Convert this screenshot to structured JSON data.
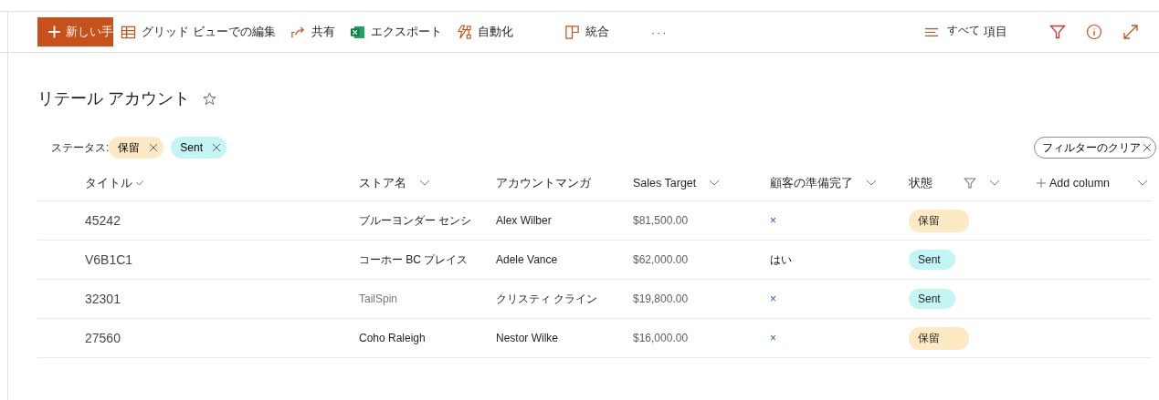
{
  "toolbar": {
    "new_button": "新しい手",
    "commands": [
      {
        "kind": "grid",
        "label": "グリッド ビューでの編集"
      },
      {
        "kind": "share",
        "label": "共有"
      },
      {
        "kind": "excel",
        "label": "エクスポート"
      },
      {
        "kind": "automate",
        "label": "自動化"
      },
      {
        "kind": "integrate",
        "label": "統合"
      },
      {
        "kind": "more",
        "label": "···"
      }
    ],
    "view": {
      "small": "すべて",
      "label": "項目"
    }
  },
  "list_title": "リテール アカウント",
  "filters": {
    "label": "ステータス:",
    "chips": [
      {
        "label": "保留",
        "color": "#fdeac4"
      },
      {
        "label": "Sent",
        "color": "#c4f5f5"
      }
    ],
    "clear": "フィルターのクリア"
  },
  "table": {
    "columns": [
      {
        "label": "タイトル",
        "kind": "sort"
      },
      {
        "label": "ストア名",
        "kind": "menu"
      },
      {
        "label": "アカウントマンガ",
        "kind": "plain"
      },
      {
        "label": "Sales Target",
        "kind": "menu"
      },
      {
        "label": "顧客の準備完了",
        "kind": "menu"
      },
      {
        "label": "状態",
        "kind": "filtered"
      },
      {
        "label": "Add column",
        "kind": "add"
      }
    ],
    "rows": [
      {
        "title": "45242",
        "store": "ブルーヨンダー センシ",
        "store_muted": false,
        "manager": "Alex Wilber",
        "sales": "$81,500.00",
        "ready": {
          "text": "×",
          "kind": "mark"
        },
        "status": {
          "label": "保留",
          "color": "#fdeac4"
        }
      },
      {
        "title": "V6B1C1",
        "store": "コーホー BC プレイス",
        "store_muted": false,
        "manager": "Adele Vance",
        "sales": "$62,000.00",
        "ready": {
          "text": "はい",
          "kind": "text"
        },
        "status": {
          "label": "Sent",
          "color": "#c4f5f5"
        }
      },
      {
        "title": "32301",
        "store": "TailSpin",
        "store_muted": true,
        "manager": "クリスティ クライン",
        "sales": "$19,800.00",
        "ready": {
          "text": "×",
          "kind": "mark"
        },
        "status": {
          "label": "Sent",
          "color": "#c4f5f5"
        }
      },
      {
        "title": "27560",
        "store": "Coho Raleigh",
        "store_muted": false,
        "manager": "Nestor Wilke",
        "sales": "$16,000.00",
        "ready": {
          "text": "×",
          "kind": "mark"
        },
        "status": {
          "label": "保留",
          "color": "#fdeac4"
        }
      }
    ]
  }
}
